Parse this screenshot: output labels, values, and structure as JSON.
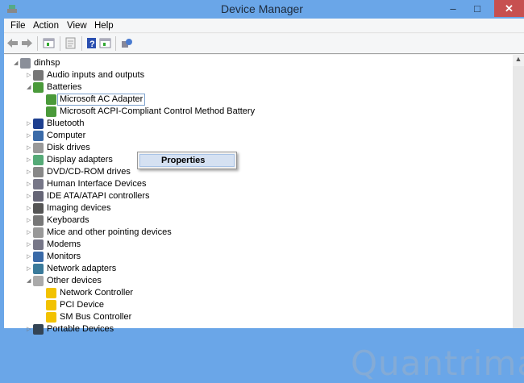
{
  "window": {
    "title": "Device Manager",
    "minimize": "–",
    "maximize": "□",
    "close": "✕"
  },
  "menu": [
    "File",
    "Action",
    "View",
    "Help"
  ],
  "toolbar": [
    "back-icon",
    "forward-icon",
    "show-hide-console-tree-icon",
    "properties-icon",
    "help-icon",
    "action-pane-icon",
    "scan-hardware-icon"
  ],
  "tree": [
    {
      "label": "dinhsp",
      "level": 0,
      "exp": "◢",
      "icon": "computer-icon"
    },
    {
      "label": "Audio inputs and outputs",
      "level": 1,
      "exp": "▷",
      "icon": "speaker-icon"
    },
    {
      "label": "Batteries",
      "level": 1,
      "exp": "◢",
      "icon": "battery-icon"
    },
    {
      "label": "Microsoft AC Adapter",
      "level": 2,
      "exp": "",
      "icon": "battery-icon",
      "selected": true
    },
    {
      "label": "Microsoft ACPI-Compliant Control Method Battery",
      "level": 2,
      "exp": "",
      "icon": "battery-icon"
    },
    {
      "label": "Bluetooth",
      "level": 1,
      "exp": "▷",
      "icon": "bluetooth-icon"
    },
    {
      "label": "Computer",
      "level": 1,
      "exp": "▷",
      "icon": "monitor-icon"
    },
    {
      "label": "Disk drives",
      "level": 1,
      "exp": "▷",
      "icon": "disk-icon"
    },
    {
      "label": "Display adapters",
      "level": 1,
      "exp": "▷",
      "icon": "display-adapter-icon"
    },
    {
      "label": "DVD/CD-ROM drives",
      "level": 1,
      "exp": "▷",
      "icon": "dvd-icon"
    },
    {
      "label": "Human Interface Devices",
      "level": 1,
      "exp": "▷",
      "icon": "hid-icon"
    },
    {
      "label": "IDE ATA/ATAPI controllers",
      "level": 1,
      "exp": "▷",
      "icon": "ide-icon"
    },
    {
      "label": "Imaging devices",
      "level": 1,
      "exp": "▷",
      "icon": "camera-icon"
    },
    {
      "label": "Keyboards",
      "level": 1,
      "exp": "▷",
      "icon": "keyboard-icon"
    },
    {
      "label": "Mice and other pointing devices",
      "level": 1,
      "exp": "▷",
      "icon": "mouse-icon"
    },
    {
      "label": "Modems",
      "level": 1,
      "exp": "▷",
      "icon": "modem-icon"
    },
    {
      "label": "Monitors",
      "level": 1,
      "exp": "▷",
      "icon": "monitor-icon"
    },
    {
      "label": "Network adapters",
      "level": 1,
      "exp": "▷",
      "icon": "network-icon"
    },
    {
      "label": "Other devices",
      "level": 1,
      "exp": "◢",
      "icon": "unknown-device-icon"
    },
    {
      "label": "Network Controller",
      "level": 2,
      "exp": "",
      "icon": "warning-device-icon"
    },
    {
      "label": "PCI Device",
      "level": 2,
      "exp": "",
      "icon": "warning-device-icon"
    },
    {
      "label": "SM Bus Controller",
      "level": 2,
      "exp": "",
      "icon": "warning-device-icon"
    },
    {
      "label": "Portable Devices",
      "level": 1,
      "exp": "▷",
      "icon": "portable-device-icon"
    }
  ],
  "context_menu": {
    "items": [
      "Properties"
    ]
  },
  "watermark": "Quantrimang",
  "colors": {
    "titlebar": "#6aa6e8",
    "close": "#c75050",
    "warning": "#f2c200"
  }
}
